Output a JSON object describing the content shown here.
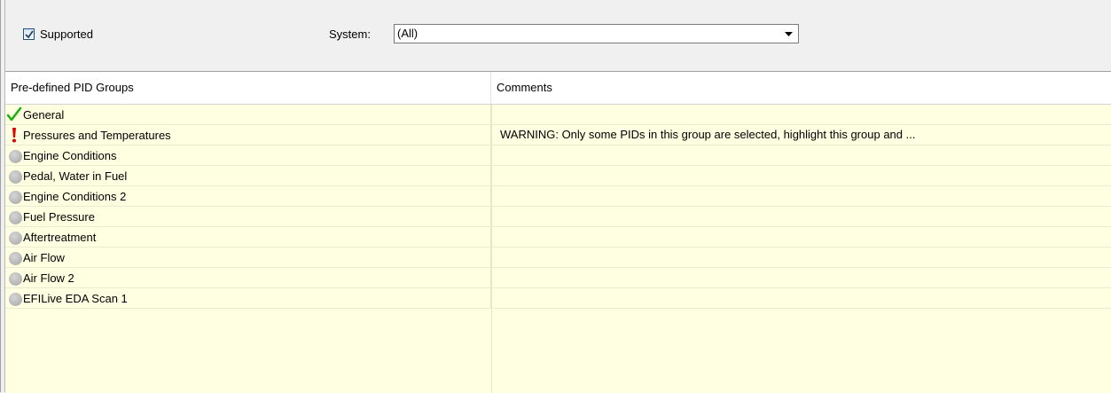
{
  "toolbar": {
    "supported_label": "Supported",
    "supported_checked": true,
    "system_label": "System:",
    "system_value": "(All)"
  },
  "grid": {
    "columns": [
      "Pre-defined PID Groups",
      "Comments"
    ],
    "rows": [
      {
        "name": "General",
        "status": "check-icon",
        "comment": ""
      },
      {
        "name": "Pressures and Temperatures",
        "status": "warning-icon",
        "comment": "WARNING: Only some PIDs in this group are selected, highlight this group and ..."
      },
      {
        "name": "Engine Conditions",
        "status": "gray-dot-icon",
        "comment": ""
      },
      {
        "name": "Pedal, Water in Fuel",
        "status": "gray-dot-icon",
        "comment": ""
      },
      {
        "name": "Engine Conditions 2",
        "status": "gray-dot-icon",
        "comment": ""
      },
      {
        "name": "Fuel Pressure",
        "status": "gray-dot-icon",
        "comment": ""
      },
      {
        "name": "Aftertreatment",
        "status": "gray-dot-icon",
        "comment": ""
      },
      {
        "name": "Air Flow",
        "status": "gray-dot-icon",
        "comment": ""
      },
      {
        "name": "Air Flow 2",
        "status": "gray-dot-icon",
        "comment": ""
      },
      {
        "name": "EFILive EDA Scan 1",
        "status": "gray-dot-icon",
        "comment": ""
      }
    ]
  },
  "colors": {
    "grid_background": "#ffffe1",
    "check_green": "#22b014",
    "warning_red": "#e00000",
    "checkbox_border": "#1c5180"
  }
}
